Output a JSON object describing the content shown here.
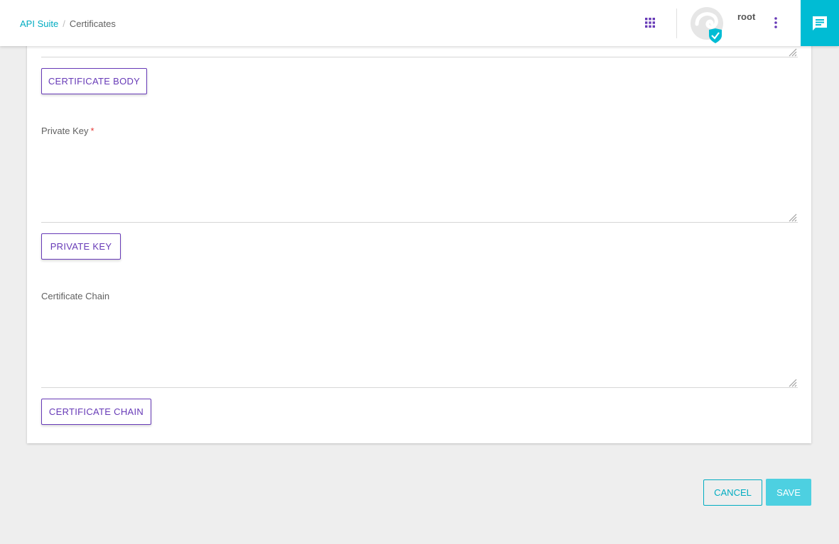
{
  "breadcrumb": {
    "root": "API Suite",
    "separator": "/",
    "current": "Certificates"
  },
  "header": {
    "apps_icon": "apps-grid-icon",
    "username": "root",
    "menu_icon": "more-vertical-icon",
    "chat_icon": "chat-message-icon"
  },
  "form": {
    "certificate_body_button": "CERTIFICATE BODY",
    "private_key_label": "Private Key",
    "private_key_required": "*",
    "private_key_value": "",
    "private_key_button": "PRIVATE KEY",
    "certificate_chain_label": "Certificate Chain",
    "certificate_chain_value": "",
    "certificate_chain_button": "CERTIFICATE CHAIN"
  },
  "actions": {
    "cancel": "CANCEL",
    "save": "SAVE"
  },
  "colors": {
    "accent": "#00bcd4",
    "primary": "#673ab7",
    "required": "#e53935"
  }
}
